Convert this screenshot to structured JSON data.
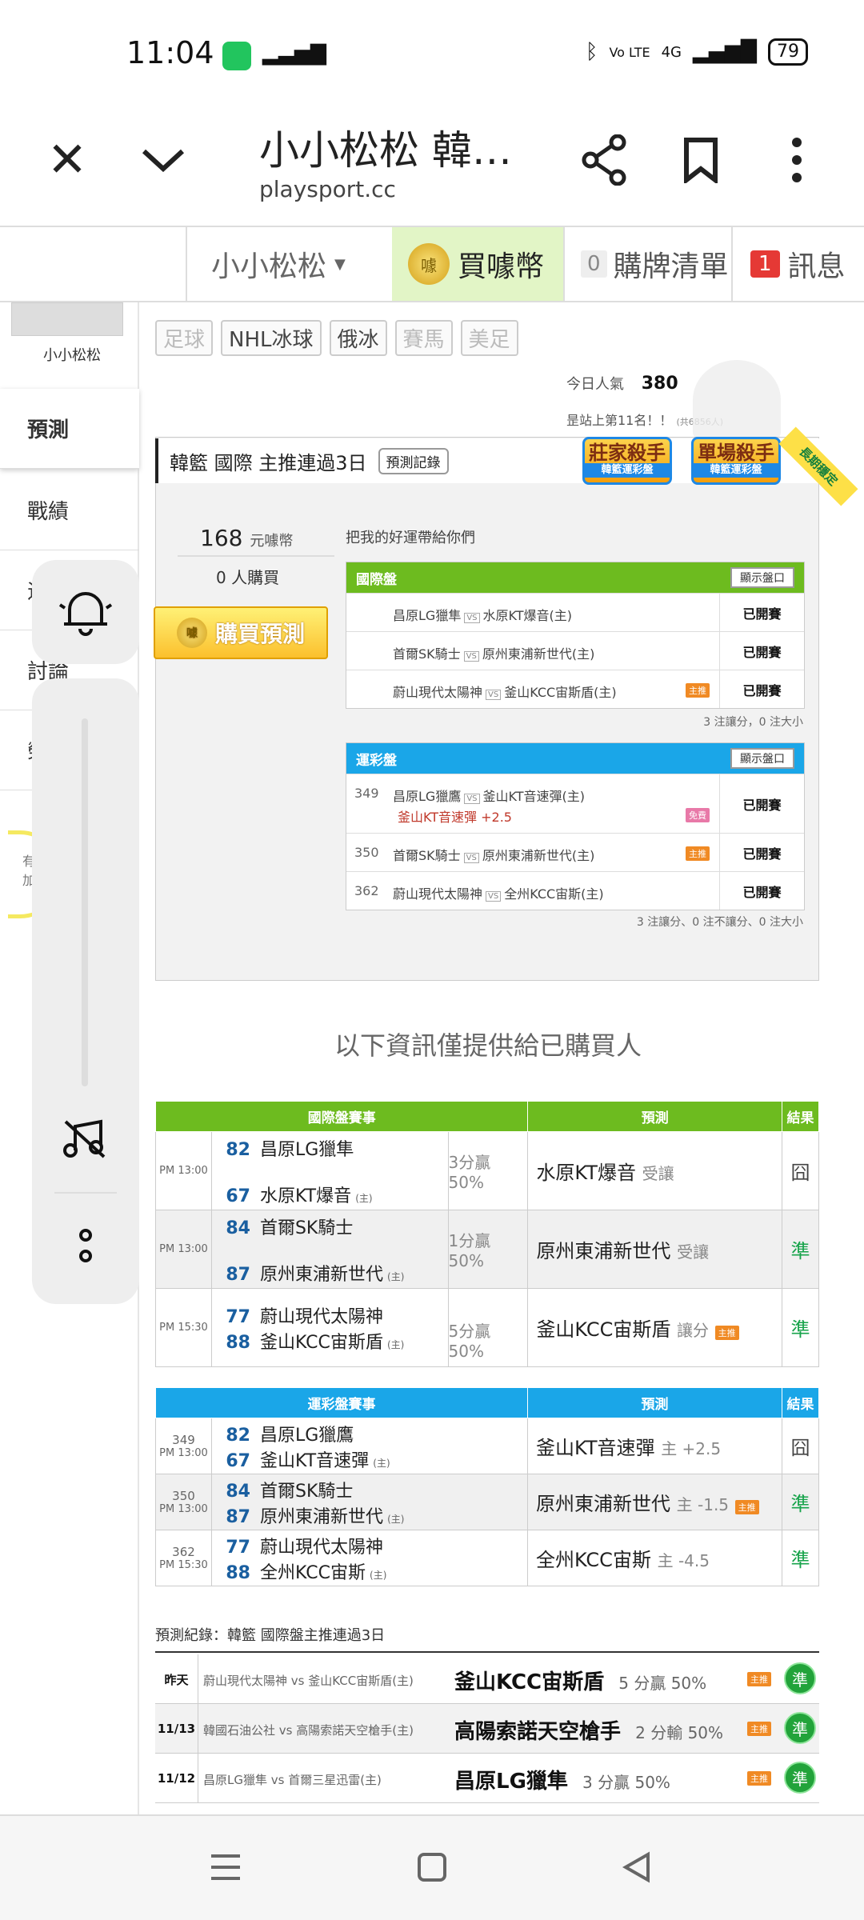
{
  "status": {
    "time": "11:04",
    "battery": "79",
    "network": "4G",
    "volte": "Vo LTE"
  },
  "browser": {
    "title": "小小松松 韓…",
    "url": "playsport.cc"
  },
  "header": {
    "user": "小小松松",
    "buy": "買噱幣",
    "list_count": "0",
    "list": "購牌清單",
    "msg_count": "1",
    "msg": "訊息",
    "coin": "噱"
  },
  "sidebar": {
    "name": "小小松松",
    "items": [
      "預測",
      "戰績",
      "這",
      "討論",
      "榮"
    ],
    "badge": "有\n加"
  },
  "tags": [
    "足球",
    "NHL冰球",
    "俄冰",
    "賽馬",
    "美足"
  ],
  "popularity": {
    "label": "今日人氣",
    "value": "380",
    "rank": "昰站上第11名！！",
    "rank_small": "(共6856人)"
  },
  "card": {
    "title": "韓籃 國際 主推連過3日",
    "record_btn": "預測記錄",
    "medal1": "莊家殺手",
    "medal1_sub": "韓籃運彩盤",
    "medal2": "單場殺手",
    "medal2_sub": "韓籃運彩盤",
    "ribbon": "長期穩定",
    "price": "168",
    "price_unit": "元噱幣",
    "buyers": "0 人購買",
    "buy_btn": "購買預測",
    "luck": "把我的好運帶給你們",
    "intl": {
      "label": "國際盤",
      "show": "顯示盤口",
      "rows": [
        {
          "a": "昌原LG獵隼",
          "b": "水原KT爆音(主)",
          "res": "已開賽"
        },
        {
          "a": "首爾SK騎士",
          "b": "原州東浦新世代(主)",
          "res": "已開賽"
        },
        {
          "a": "蔚山現代太陽神",
          "b": "釜山KCC宙斯盾(主)",
          "tag": "主推",
          "res": "已開賽"
        }
      ],
      "note": "3 注讓分，0 注大小"
    },
    "lottery": {
      "label": "運彩盤",
      "show": "顯示盤口",
      "rows": [
        {
          "no": "349",
          "a": "昌原LG獵鷹",
          "b": "釜山KT音速彈(主)",
          "sub": "釜山KT音速彈 +2.5",
          "tag": "免費",
          "res": "已開賽"
        },
        {
          "no": "350",
          "a": "首爾SK騎士",
          "b": "原州東浦新世代(主)",
          "tag": "主推",
          "res": "已開賽"
        },
        {
          "no": "362",
          "a": "蔚山現代太陽神",
          "b": "全州KCC宙斯(主)",
          "res": "已開賽"
        }
      ],
      "note": "3 注讓分、0 注不讓分、0 注大小"
    }
  },
  "info_head": "以下資訊僅提供給已購買人",
  "intl_table": {
    "headers": [
      "國際盤賽事",
      "預測",
      "結果"
    ],
    "rows": [
      {
        "time": "PM 13:00",
        "s1": "82",
        "t1": "昌原LG獵隼",
        "s2": "67",
        "t2": "水原KT爆音",
        "host": "(主)",
        "stat": "3分贏",
        "pct": "50%",
        "pred": "水原KT爆音",
        "pred_sub": "受讓",
        "res": "囧"
      },
      {
        "time": "PM 13:00",
        "s1": "84",
        "t1": "首爾SK騎士",
        "s2": "87",
        "t2": "原州東浦新世代",
        "host": "(主)",
        "stat": "1分贏",
        "pct": "50%",
        "pred": "原州東浦新世代",
        "pred_sub": "受讓",
        "res": "準"
      },
      {
        "time": "PM 15:30",
        "s1": "77",
        "t1": "蔚山現代太陽神",
        "s2": "88",
        "t2": "釜山KCC宙斯盾",
        "host": "(主)",
        "stat": "5分贏",
        "pct": "50%",
        "pred": "釜山KCC宙斯盾",
        "pred_sub": "讓分",
        "tag": "主推",
        "res": "準"
      }
    ]
  },
  "lot_table": {
    "headers": [
      "運彩盤賽事",
      "預測",
      "結果"
    ],
    "rows": [
      {
        "no": "349",
        "time": "PM 13:00",
        "s1": "82",
        "t1": "昌原LG獵鷹",
        "s2": "67",
        "t2": "釜山KT音速彈",
        "host": "(主)",
        "pred": "釜山KT音速彈",
        "pred_sub": "主 +2.5",
        "res": "囧"
      },
      {
        "no": "350",
        "time": "PM 13:00",
        "s1": "84",
        "t1": "首爾SK騎士",
        "s2": "87",
        "t2": "原州東浦新世代",
        "host": "(主)",
        "pred": "原州東浦新世代",
        "pred_sub": "主 -1.5",
        "tag": "主推",
        "res": "準"
      },
      {
        "no": "362",
        "time": "PM 15:30",
        "s1": "77",
        "t1": "蔚山現代太陽神",
        "s2": "88",
        "t2": "全州KCC宙斯",
        "host": "(主)",
        "pred": "全州KCC宙斯",
        "pred_sub": "主 -4.5",
        "res": "準"
      }
    ]
  },
  "records": {
    "head": "預測紀錄：韓籃 國際盤主推連過3日",
    "rows": [
      {
        "date": "昨天",
        "game": "蔚山現代太陽神 vs 釜山KCC宙斯盾(主)",
        "pick": "釜山KCC宙斯盾",
        "detail": "5 分贏 50%",
        "tag": "主推",
        "res": "準"
      },
      {
        "date": "11/13",
        "game": "韓國石油公社 vs 高陽索諾天空槍手(主)",
        "pick": "高陽索諾天空槍手",
        "detail": "2 分輸 50%",
        "tag": "主推",
        "res": "準"
      },
      {
        "date": "11/12",
        "game": "昌原LG獵隼 vs 首爾三星迅雷(主)",
        "pick": "昌原LG獵隼",
        "detail": "3 分贏 50%",
        "tag": "主推",
        "res": "準"
      }
    ]
  },
  "colors": {
    "green": "#6dbb1f",
    "blue": "#1aa6e8",
    "score": "#1a5fa0"
  }
}
